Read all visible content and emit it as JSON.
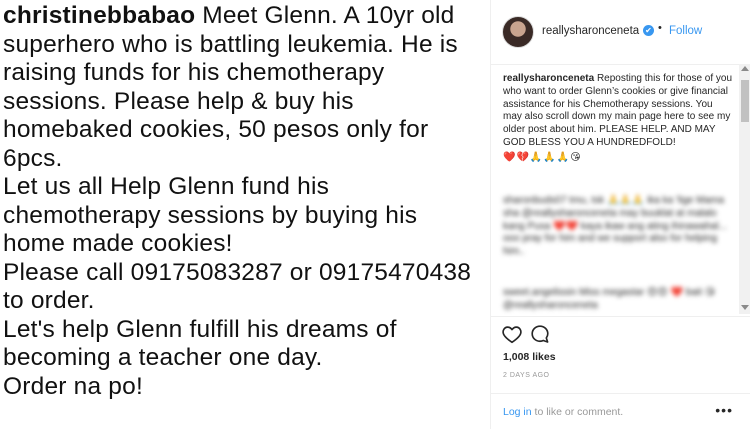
{
  "post": {
    "username": "christinebbabao",
    "caption_lead": " Meet Glenn. A 10yr old superhero who is battling leukemia. He is raising funds for his chemotherapy sessions. Please help & buy his homebaked cookies, 50 pesos only for 6pcs.",
    "line2": "Let us all Help Glenn fund his chemotherapy sessions by buying his home made cookies!",
    "line3": "Please call 09175083287 or 09175470438 to order.",
    "line4": "Let's help Glenn fulfill his dreams of becoming a teacher one day.",
    "line5": "Order na po!"
  },
  "panel": {
    "username": "reallysharonceneta",
    "verified_icon": "✔",
    "separator": "•",
    "follow_label": "Follow",
    "caption_user": "reallysharonceneta",
    "caption_text": " Reposting this for those of you who want to order Glenn’s cookies or give financial assistance for his Chemotherapy sessions. You may also scroll down my main page here to see my older post about him. PLEASE HELP. AND MAY GOD BLESS YOU A HUNDREDFOLD!",
    "caption_emojis": "❤️💔🙏🙏🙏😘",
    "blurred_comment_1": "sharonbuds07 tmu, tsk 🙏🙏🙏 ika ka 'lige Mama sha @reallysharonceneta may buuklat at malalo kang Pusa ❤️❤️ kaya ikaw ang ating ihinawahal... ooo pray for him and we support also for helping him..",
    "blurred_comment_2": "sweet.angelissin Miss megastar 😍😍 ❤️ bait 😘 @reallysharonceneta",
    "likes": "1,008 likes",
    "date": "2 DAYS AGO",
    "login_link": "Log in",
    "login_rest": " to like or comment.",
    "more_icon": "•••"
  },
  "colors": {
    "link_blue": "#3897f0",
    "text": "#262626",
    "muted": "#999999"
  }
}
